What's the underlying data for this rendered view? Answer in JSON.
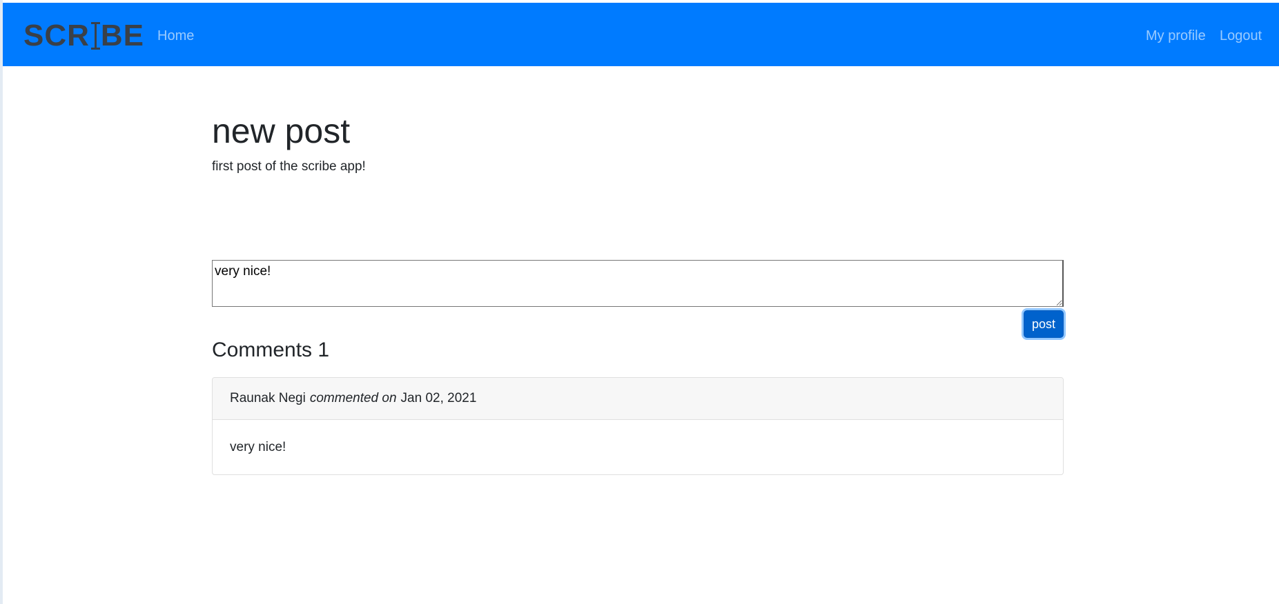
{
  "navbar": {
    "brand_left": "SCR",
    "brand_right": "BE",
    "home_label": "Home",
    "profile_label": "My profile",
    "logout_label": "Logout",
    "background_color": "#007bff"
  },
  "post": {
    "title": "new post",
    "body": "first post of the scribe app!"
  },
  "comment_form": {
    "value": "very nice!",
    "submit_label": "post"
  },
  "comments": {
    "heading": "Comments 1",
    "items": [
      {
        "author": "Raunak Negi",
        "action": "commented on",
        "date": "Jan 02, 2021",
        "text": "very nice!"
      }
    ]
  }
}
